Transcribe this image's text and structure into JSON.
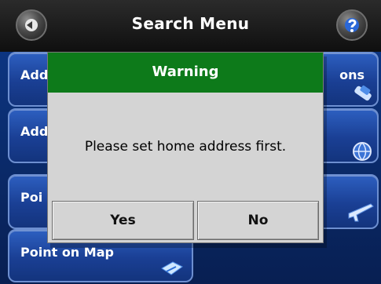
{
  "header": {
    "title": "Search Menu",
    "back_icon": "back-arrow-icon",
    "help_icon": "help-icon"
  },
  "menu": {
    "items": [
      {
        "label": "Add",
        "icon": ""
      },
      {
        "label": "ons",
        "icon": "car-icon"
      },
      {
        "label": "Add",
        "icon": ""
      },
      {
        "label": "",
        "icon": "globe-icon"
      },
      {
        "label": "Poi",
        "icon": ""
      },
      {
        "label": "",
        "icon": "airplane-icon"
      },
      {
        "label": "Point on Map",
        "icon": "map-pin-icon"
      }
    ]
  },
  "dialog": {
    "title": "Warning",
    "message": "Please set home address first.",
    "yes_label": "Yes",
    "no_label": "No"
  },
  "colors": {
    "header_bg": "#141414",
    "tile_bg": "#1a3f94",
    "tile_border": "#6d8fd0",
    "dialog_bg": "#d4d4d4",
    "dialog_header": "#0d7a1a"
  }
}
